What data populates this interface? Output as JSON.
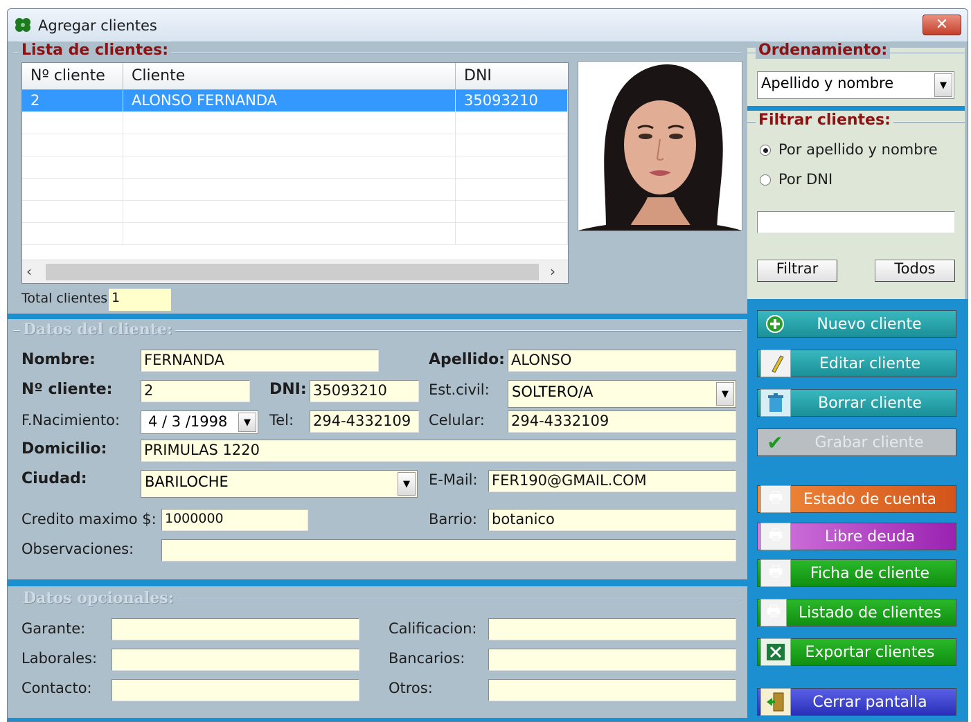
{
  "window": {
    "title": "Agregar clientes",
    "close_symbol": "✕"
  },
  "clients_list": {
    "title": "Lista de clientes:",
    "columns": [
      "Nº cliente",
      "Cliente",
      "DNI"
    ],
    "rows": [
      {
        "num": "2",
        "name": "ALONSO FERNANDA",
        "dni": "35093210"
      }
    ],
    "total_label": "Total clientes:",
    "total_value": "1"
  },
  "sort": {
    "title": "Ordenamiento:",
    "selected": "Apellido y nombre"
  },
  "filter": {
    "title": "Filtrar clientes:",
    "options": [
      "Por apellido y nombre",
      "Por DNI"
    ],
    "selected_index": 0,
    "text_value": "",
    "filter_button": "Filtrar",
    "all_button": "Todos"
  },
  "client_data": {
    "title": "Datos del cliente:",
    "nombre_label": "Nombre:",
    "nombre": "FERNANDA",
    "apellido_label": "Apellido:",
    "apellido": "ALONSO",
    "num_label": "Nº cliente:",
    "num": "2",
    "dni_label": "DNI:",
    "dni": "35093210",
    "estcivil_label": "Est.civil:",
    "estcivil": "SOLTERO/A",
    "nac_label": "F.Nacimiento:",
    "nac": "4 / 3 /1998",
    "tel_label": "Tel:",
    "tel": "294-4332109",
    "celular_label": "Celular:",
    "celular": "294-4332109",
    "domicilio_label": "Domicilio:",
    "domicilio": "PRIMULAS 1220",
    "ciudad_label": "Ciudad:",
    "ciudad": "BARILOCHE",
    "email_label": "E-Mail:",
    "email": "FER190@GMAIL.COM",
    "credito_label": "Credito maximo $:",
    "credito": "1000000",
    "barrio_label": "Barrio:",
    "barrio": "botanico",
    "obs_label": "Observaciones:",
    "obs": ""
  },
  "optional_data": {
    "title": "Datos opcionales:",
    "garante_label": "Garante:",
    "garante": "",
    "laborales_label": "Laborales:",
    "laborales": "",
    "contacto_label": "Contacto:",
    "contacto": "",
    "calificacion_label": "Calificacion:",
    "calificacion": "",
    "bancarios_label": "Bancarios:",
    "bancarios": "",
    "otros_label": "Otros:",
    "otros": ""
  },
  "actions": {
    "nuevo": "Nuevo cliente",
    "editar": "Editar cliente",
    "borrar": "Borrar cliente",
    "grabar": "Grabar cliente",
    "estado": "Estado de cuenta",
    "libre": "Libre deuda",
    "ficha": "Ficha de cliente",
    "listado": "Listado de clientes",
    "exportar": "Exportar clientes",
    "cerrar": "Cerrar pantalla"
  },
  "colors": {
    "teal": "#1f9ea5",
    "gray_disabled": "#b9bec2",
    "orange": "#e2621c",
    "purple": "#a530b6",
    "green": "#1aa01a",
    "blue": "#3a3fd0",
    "accent_blue": "#1b8fd0",
    "title_red": "#8b1313",
    "field_yellow": "#ffffe1"
  },
  "icons": {
    "app": "clover-icon",
    "nuevo": "plus-circle-icon",
    "editar": "pencil-icon",
    "borrar": "trash-icon",
    "grabar": "checkmark-icon",
    "print": "printer-icon",
    "excel": "excel-icon",
    "cerrar": "exit-door-icon"
  }
}
